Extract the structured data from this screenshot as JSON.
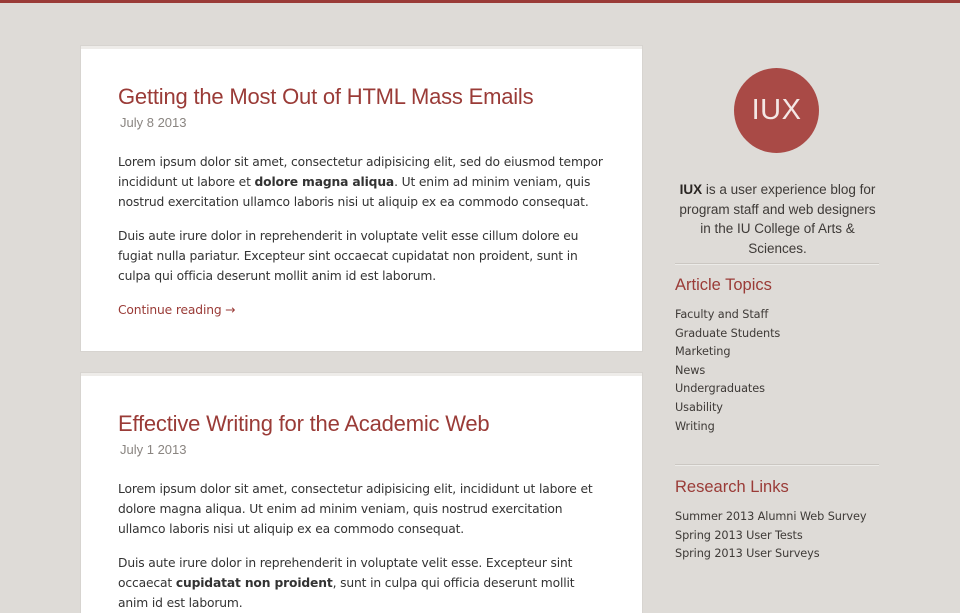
{
  "articles": [
    {
      "title": "Getting the Most Out of HTML Mass Emails",
      "date": "July 8 2013",
      "p1_a": "Lorem ipsum dolor sit amet, consectetur adipisicing elit, sed do eiusmod tempor incididunt ut labore et ",
      "p1_bold": "dolore magna aliqua",
      "p1_b": ". Ut enim ad minim veniam, quis nostrud exercitation ullamco laboris nisi ut aliquip ex ea commodo consequat.",
      "p2": "Duis aute irure dolor in reprehenderit in voluptate velit esse cillum dolore eu fugiat nulla pariatur. Excepteur sint occaecat cupidatat non proident, sunt in culpa qui officia deserunt mollit anim id est laborum.",
      "continue": "Continue reading →"
    },
    {
      "title": "Effective Writing for the Academic Web",
      "date": "July 1 2013",
      "p1": "Lorem ipsum dolor sit amet, consectetur adipisicing elit, incididunt ut labore et dolore magna aliqua. Ut enim ad minim veniam, quis nostrud exercitation ullamco laboris nisi ut aliquip ex ea commodo consequat.",
      "p2_a": "Duis aute irure dolor in reprehenderit in voluptate velit esse. Excepteur sint occaecat ",
      "p2_bold": "cupidatat non proident",
      "p2_b": ", sunt in culpa qui officia deserunt mollit anim id est laborum."
    }
  ],
  "sidebar": {
    "logo_text": "IUX",
    "about_bold": "IUX",
    "about_rest": " is a user experience blog for program staff and web designers in the IU College of Arts & Sciences.",
    "topics_heading": "Article Topics",
    "topics": [
      "Faculty and Staff",
      "Graduate Students",
      "Marketing",
      "News",
      "Undergraduates",
      "Usability",
      "Writing"
    ],
    "links_heading": "Research Links",
    "links": [
      "Summer 2013 Alumni Web Survey",
      "Spring 2013 User Tests",
      "Spring 2013 User Surveys"
    ]
  },
  "colors": {
    "accent": "#9a3b37",
    "logo_bg": "#a94a46",
    "page_bg": "#dedbd7",
    "card_bg": "#ffffff"
  }
}
